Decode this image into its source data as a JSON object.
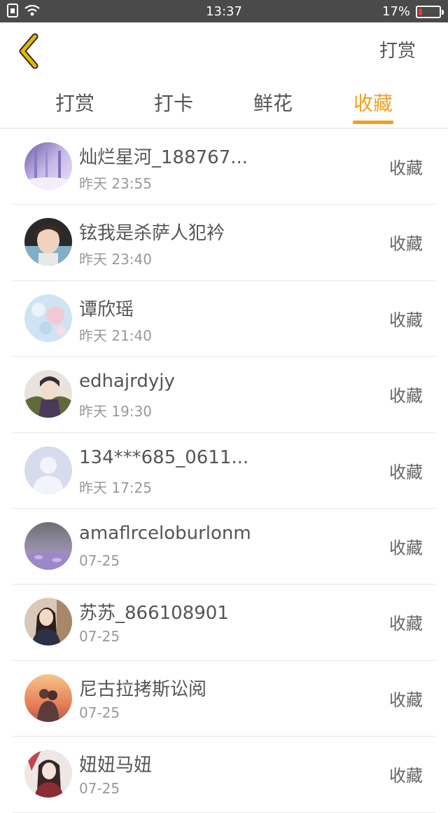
{
  "status_bar": {
    "time": "13:37",
    "battery": "17%",
    "battery_level": 0.17,
    "battery_color": "#e53935",
    "icons": [
      "sim-card-icon",
      "wifi-icon"
    ]
  },
  "header": {
    "back_icon": "chevron-left-icon",
    "back_color": "#e8b800",
    "action_label": "打赏"
  },
  "tabs": {
    "active_color": "#f0a020",
    "items": [
      {
        "label": "打赏",
        "active": false
      },
      {
        "label": "打卡",
        "active": false
      },
      {
        "label": "鲜花",
        "active": false
      },
      {
        "label": "收藏",
        "active": true
      }
    ]
  },
  "list": {
    "items": [
      {
        "name": "灿烂星河_188767...",
        "time": "昨天 23:55",
        "action": "收藏",
        "avatar": "purple-forest"
      },
      {
        "name": "铉我是杀萨人犯衿",
        "time": "昨天 23:40",
        "action": "收藏",
        "avatar": "boy-photo"
      },
      {
        "name": "谭欣瑶",
        "time": "昨天 21:40",
        "action": "收藏",
        "avatar": "pastel-flowers"
      },
      {
        "name": "edhajrdyjy",
        "time": "昨天 19:30",
        "action": "收藏",
        "avatar": "anime-character"
      },
      {
        "name": "134***685_0611...",
        "time": "昨天 17:25",
        "action": "收藏",
        "avatar": "default-silhouette"
      },
      {
        "name": "amaflrceloburlonm",
        "time": "07-25",
        "action": "收藏",
        "avatar": "lavender-field"
      },
      {
        "name": "苏苏_866108901",
        "time": "07-25",
        "action": "收藏",
        "avatar": "girl-photo"
      },
      {
        "name": "尼古拉拷斯讼阅",
        "time": "07-25",
        "action": "收藏",
        "avatar": "sunset-couple"
      },
      {
        "name": "妞妞马妞",
        "time": "07-25",
        "action": "收藏",
        "avatar": "anime-girl"
      }
    ]
  }
}
